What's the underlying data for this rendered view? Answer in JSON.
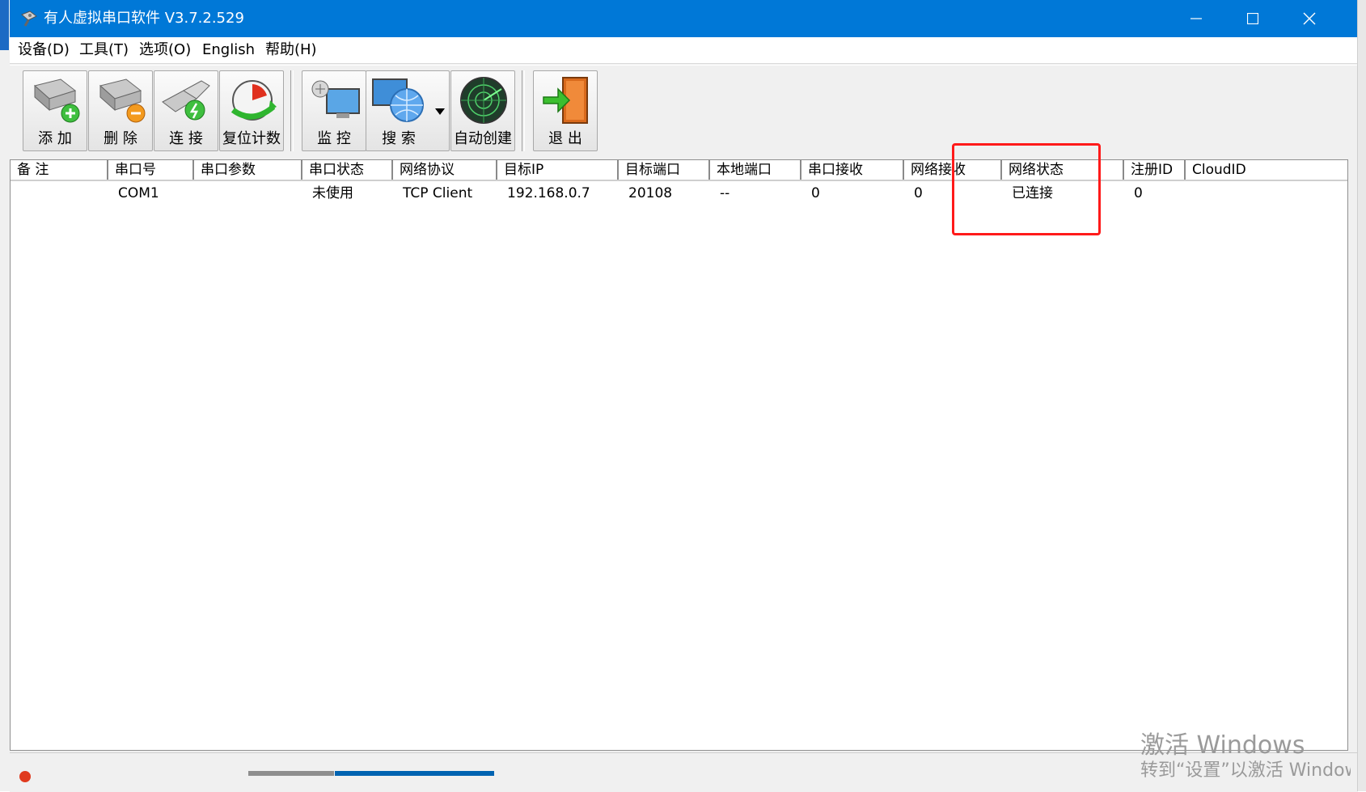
{
  "window": {
    "title": "有人虚拟串口软件 V3.7.2.529"
  },
  "menubar": {
    "items": [
      {
        "label": "设备(D)"
      },
      {
        "label": "工具(T)"
      },
      {
        "label": "选项(O)"
      },
      {
        "label": "English"
      },
      {
        "label": "帮助(H)"
      }
    ]
  },
  "toolbar": {
    "buttons": [
      {
        "label": "添 加",
        "icon": "serial-port-add-icon"
      },
      {
        "label": "删 除",
        "icon": "serial-port-remove-icon"
      },
      {
        "label": "连 接",
        "icon": "network-connect-icon"
      },
      {
        "label": "复位计数",
        "icon": "reset-counter-icon"
      },
      {
        "label": "监 控",
        "icon": "monitor-icon"
      },
      {
        "label": "搜 索",
        "icon": "search-globe-icon"
      },
      {
        "label": "自动创建",
        "icon": "radar-icon"
      },
      {
        "label": "退 出",
        "icon": "exit-door-icon"
      }
    ]
  },
  "list": {
    "columns": [
      "备 注",
      "串口号",
      "串口参数",
      "串口状态",
      "网络协议",
      "目标IP",
      "目标端口",
      "本地端口",
      "串口接收",
      "网络接收",
      "网络状态",
      "注册ID",
      "CloudID"
    ],
    "rows": [
      {
        "note": "",
        "port": "COM1",
        "params": "",
        "port_status": "未使用",
        "protocol": "TCP Client",
        "target_ip": "192.168.0.7",
        "target_port": "20108",
        "local_port": "--",
        "serial_rx": "0",
        "net_rx": "0",
        "net_status": "已连接",
        "register_id": "0",
        "cloud_id": ""
      }
    ]
  },
  "watermark": {
    "line1": "激活 Windows",
    "line2": "转到“设置”以激活 Windows"
  },
  "colors": {
    "titlebar": "#0078d7",
    "highlight": "#ff1a1a"
  }
}
